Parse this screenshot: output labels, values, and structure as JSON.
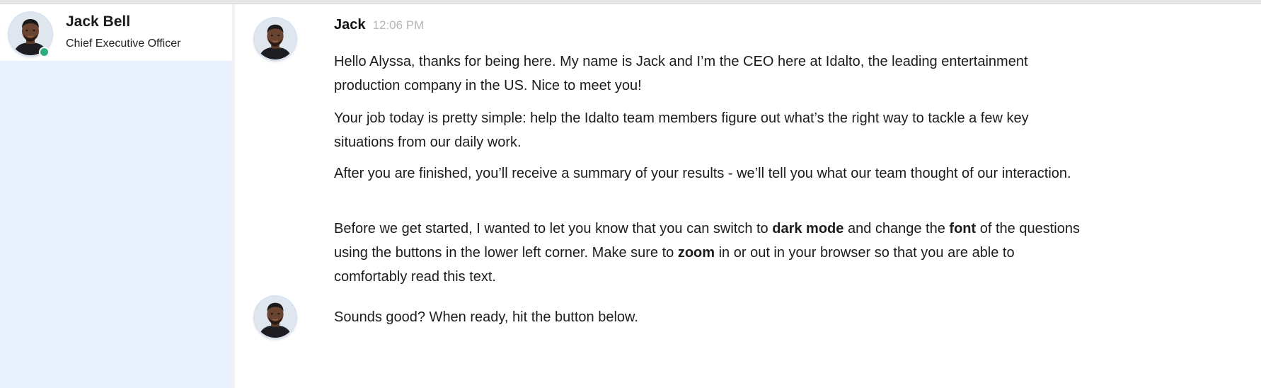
{
  "contact": {
    "name": "Jack Bell",
    "title": "Chief Executive Officer",
    "status": "online"
  },
  "conversation": {
    "sender": "Jack",
    "time": "12:06 PM",
    "messages": [
      {
        "text": "Hello Alyssa, thanks for being here. My name is Jack and I’m the CEO here at Idalto, the leading entertainment production company in the US. Nice to meet you!"
      },
      {
        "text": "Your job today is pretty simple: help the Idalto team members figure out what’s the right way to tackle a few key situations from our daily work."
      },
      {
        "text": "After you are finished, you’ll receive a summary of your results - we’ll tell you what our team thought of our interaction."
      },
      {
        "segments": [
          "Before we get started, I wanted to let you know that you can switch to ",
          "dark mode",
          " and change the ",
          "font",
          " of the questions using the buttons in the lower left corner. Make sure to ",
          "zoom",
          " in or out in your browser so that you are able to comfortably read this text."
        ]
      },
      {
        "text": "Sounds good? When ready, hit the button below."
      }
    ]
  },
  "colors": {
    "sidebar_bg": "#e8f0fe",
    "status_online": "#2fae7d",
    "timestamp": "#b5b5b5"
  }
}
